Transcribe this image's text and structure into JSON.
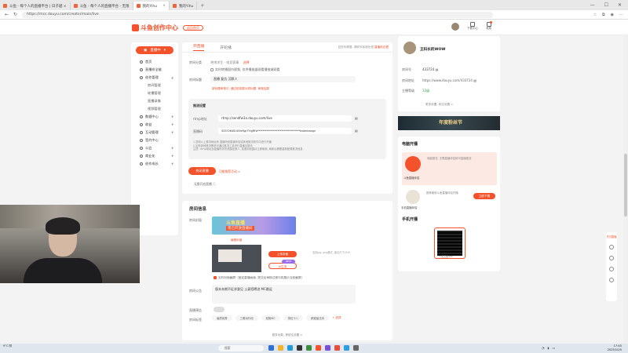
{
  "browser": {
    "tabs": [
      {
        "title": "斗鱼 - 每个人的直播平台 | 日子越 ×"
      },
      {
        "title": "斗鱼 - 每个人的直播平台 - 无限"
      },
      {
        "title": "我的Yihu"
      },
      {
        "title": "我的Yihu"
      }
    ],
    "new_tab": "+",
    "url": "https://mcs.douyu.com/creator/main/live"
  },
  "header": {
    "logo_text": "斗鱼创作中心",
    "logo_sub": "返回首页",
    "icons": [
      {
        "label": "下载中心"
      },
      {
        "label": "消息"
      }
    ]
  },
  "sidebar": {
    "live_button": "直播中",
    "items": [
      {
        "label": "首页",
        "type": "top"
      },
      {
        "label": "直播伴全能",
        "type": "top"
      },
      {
        "label": "创作管理",
        "type": "top",
        "arrow": "▲"
      },
      {
        "label": "房间管理",
        "type": "sub"
      },
      {
        "label": "轮播管理",
        "type": "sub"
      },
      {
        "label": "直播录像",
        "type": "sub"
      },
      {
        "label": "视频管理",
        "type": "sub"
      },
      {
        "label": "数据中心",
        "type": "top",
        "arrow": "▼"
      },
      {
        "label": "收益",
        "type": "top",
        "arrow": "▼"
      },
      {
        "label": "互动管理",
        "type": "top",
        "arrow": "▼"
      },
      {
        "label": "签约中心",
        "type": "top"
      },
      {
        "label": "公会",
        "type": "top",
        "arrow": "▼"
      },
      {
        "label": "商业化",
        "type": "top",
        "arrow": "▼"
      },
      {
        "label": "创作成长",
        "type": "top",
        "arrow": "▼"
      }
    ]
  },
  "main": {
    "tab_live": "开直播",
    "tab_playback": "开轮播",
    "hint": "如您有需要, 请联系客服处理",
    "hint_link": "直播前必看",
    "room_type_label": "房间分类",
    "room_type_value": "绝地求生 - 电竞赛事",
    "room_type_link": "选择",
    "checkbox1": "实时转播国内视频, 仅供播放器观看播放端观看",
    "room_title_label": "房间标题",
    "room_title_value": "直播 复仇 沉默人",
    "title_tip": "新标题审核中, 通过前将展示原标题, 审核结果",
    "stream_title": "推流设置",
    "rtmp_label": "rtmp地址",
    "rtmp_value": "rtmp://sendfw3a.douyu.com/live",
    "code_label": "直播码",
    "code_value": "4337264SUU5eRgr7YqJRFa********************************ksdmkwsgn",
    "notes": [
      "1.复制以上推流地址和 直播码到直播伴侣或其他推流软件中进行开播",
      "2.如有其他推流需求可通过推流工具进行直播中推流",
      "注意: rtmp地址及直播码请勿泄露给他人, 如遭到泄露请立即刷新, 刷新后需要重新配置推流信息"
    ],
    "start_button": "关闭直播",
    "copy_link": "功能推荐活动 >",
    "pc_tip": "无需开启直播 ⓘ"
  },
  "room": {
    "heading": "房间信息",
    "cover_label": "房间封面",
    "cover_title": "斗鱼直播",
    "cover_sub": "现已开放直播间",
    "cover_link": "编辑封面",
    "upload_btn": "上传封面",
    "ai_btn": "AI生成",
    "ai_badge": "NEW",
    "cover_note": "支持jpg, png格式, 建议尺寸16:9",
    "checkbox_auto": "实时封面截屏（固定直播画面, 提交后审核过程中将展示当前截屏）",
    "notice_label": "房间公告",
    "notice_value": "版本本期不征求意见 土豪招聘进 MC跳运",
    "privacy_label": "直播预告",
    "tags_label": "房间标签",
    "tags": [
      "画质优秀",
      "三角洲行动",
      "双枪MC",
      "排位十八",
      "精准狙击手"
    ],
    "tags_link": "+ 选择",
    "footer": "更多功能, 请前往设置 >"
  },
  "profile": {
    "name": "王科长的WOW",
    "room_id_label": "房间号",
    "room_id": "433724",
    "link_label": "房间地址",
    "link": "https://www.douyu.com/433724",
    "level_label": "主播等级",
    "level": "12级",
    "more": "更多设置, 前往设置 >"
  },
  "banner": {
    "text": "年度粉丝节"
  },
  "pc_live": {
    "title": "电脑开播",
    "desc1": "电脑推流, 无需直播伴侣即可直播推流",
    "btn1_label": "斗鱼直播伴侣",
    "desc2": "推荐使用斗鱼直播伴侣开播",
    "btn2": "立即下载",
    "btn2_label": "手机直播伴侣"
  },
  "mobile_live": {
    "title": "手机开播",
    "qr_caption": "斗鱼直播APP"
  },
  "floatbar": {
    "items": [
      "先试直播",
      "反馈",
      "客服"
    ]
  },
  "taskbar": {
    "weather": "9°C 阴",
    "search": "搜索",
    "time": "17:45",
    "date": "2025/10/5"
  },
  "colors": {
    "accent": "#f3522b",
    "bg": "#f3f3f3"
  }
}
